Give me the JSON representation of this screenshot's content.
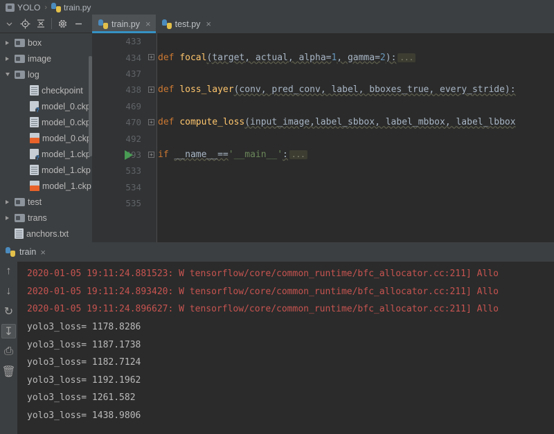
{
  "breadcrumb": {
    "project": "YOLO",
    "separator": "›",
    "file": "train.py"
  },
  "sidebar": {
    "toolbar": [
      {
        "name": "chevron-down-icon",
        "label": "▾"
      },
      {
        "name": "locate-icon",
        "label": "⊕"
      },
      {
        "name": "collapse-all-icon",
        "label": "≡"
      },
      {
        "name": "settings-gear-icon",
        "label": "⚙"
      },
      {
        "name": "hide-icon",
        "label": "—"
      }
    ],
    "tree": [
      {
        "label": "box",
        "kind": "folder",
        "expanded": false,
        "indent": 1
      },
      {
        "label": "image",
        "kind": "folder",
        "expanded": false,
        "indent": 1
      },
      {
        "label": "log",
        "kind": "folder",
        "expanded": true,
        "indent": 1
      },
      {
        "label": "checkpoint",
        "kind": "file",
        "indent": 2
      },
      {
        "label": "model_0.ckp",
        "kind": "file-q",
        "indent": 2
      },
      {
        "label": "model_0.ckp",
        "kind": "file",
        "indent": 2
      },
      {
        "label": "model_0.ckp",
        "kind": "file-red",
        "indent": 2
      },
      {
        "label": "model_1.ckp",
        "kind": "file-q",
        "indent": 2
      },
      {
        "label": "model_1.ckp",
        "kind": "file",
        "indent": 2
      },
      {
        "label": "model_1.ckp",
        "kind": "file-red",
        "indent": 2
      },
      {
        "label": "test",
        "kind": "folder",
        "expanded": false,
        "indent": 1
      },
      {
        "label": "trans",
        "kind": "folder",
        "expanded": false,
        "indent": 1
      },
      {
        "label": "anchors.txt",
        "kind": "file",
        "indent": 1
      }
    ]
  },
  "editor": {
    "tabs": [
      {
        "label": "train.py",
        "active": true,
        "close": "×"
      },
      {
        "label": "test.py",
        "active": false,
        "close": "×"
      }
    ],
    "lines": [
      {
        "number": "433",
        "fold": false,
        "run": false,
        "segments": []
      },
      {
        "number": "434",
        "fold": true,
        "run": false,
        "segments": [
          {
            "t": "def ",
            "c": "kw"
          },
          {
            "t": "focal",
            "c": "fn"
          },
          {
            "t": "(target, actual, alpha=",
            "c": "pl"
          },
          {
            "t": "1",
            "c": "num"
          },
          {
            "t": ", gamma=",
            "c": "pl"
          },
          {
            "t": "2",
            "c": "num"
          },
          {
            "t": "):",
            "c": "pl"
          },
          {
            "t": "...",
            "c": "ellipsis"
          }
        ]
      },
      {
        "number": "437",
        "fold": false,
        "run": false,
        "segments": []
      },
      {
        "number": "438",
        "fold": true,
        "run": false,
        "segments": [
          {
            "t": "def ",
            "c": "kw"
          },
          {
            "t": "loss_layer",
            "c": "fn"
          },
          {
            "t": "(conv, pred_conv, label, bboxes_true, every_stride):",
            "c": "pl"
          }
        ]
      },
      {
        "number": "469",
        "fold": false,
        "run": false,
        "segments": []
      },
      {
        "number": "470",
        "fold": true,
        "run": false,
        "segments": [
          {
            "t": "def ",
            "c": "kw"
          },
          {
            "t": "compute_loss",
            "c": "fn"
          },
          {
            "t": "(input_image,label_sbbox, label_mbbox, label_lbbox",
            "c": "pl"
          }
        ]
      },
      {
        "number": "492",
        "fold": false,
        "run": false,
        "segments": []
      },
      {
        "number": "493",
        "fold": true,
        "run": true,
        "segments": [
          {
            "t": "if ",
            "c": "kw"
          },
          {
            "t": "__name__==",
            "c": "pl"
          },
          {
            "t": "'__main__'",
            "c": "str"
          },
          {
            "t": ":",
            "c": "pl"
          },
          {
            "t": "...",
            "c": "ellipsis"
          }
        ]
      },
      {
        "number": "533",
        "fold": false,
        "run": false,
        "segments": []
      },
      {
        "number": "534",
        "fold": false,
        "run": false,
        "segments": []
      },
      {
        "number": "535",
        "fold": false,
        "run": false,
        "segments": []
      }
    ]
  },
  "console": {
    "tab": {
      "label": "train",
      "close": "×"
    },
    "gutter_buttons": [
      {
        "name": "rerun-up-icon",
        "glyph": "↑",
        "selected": false
      },
      {
        "name": "stop-down-icon",
        "glyph": "↓",
        "selected": false
      },
      {
        "name": "rerun-loop-icon",
        "glyph": "↻",
        "selected": false
      },
      {
        "name": "scroll-to-end-icon",
        "glyph": "↧",
        "selected": true
      },
      {
        "name": "print-icon",
        "glyph": "⎙",
        "selected": false
      },
      {
        "name": "trash-icon",
        "glyph": "🗑",
        "selected": false
      }
    ],
    "output": [
      {
        "text": "2020-01-05 19:11:24.881523: W tensorflow/core/common_runtime/bfc_allocator.cc:211] Allo",
        "type": "warn"
      },
      {
        "text": "2020-01-05 19:11:24.893420: W tensorflow/core/common_runtime/bfc_allocator.cc:211] Allo",
        "type": "warn"
      },
      {
        "text": "2020-01-05 19:11:24.896627: W tensorflow/core/common_runtime/bfc_allocator.cc:211] Allo",
        "type": "warn"
      },
      {
        "text": "yolo3_loss= 1178.8286",
        "type": "norm"
      },
      {
        "text": "yolo3_loss= 1187.1738",
        "type": "norm"
      },
      {
        "text": "yolo3_loss= 1182.7124",
        "type": "norm"
      },
      {
        "text": "yolo3_loss= 1192.1962",
        "type": "norm"
      },
      {
        "text": "yolo3_loss= 1261.582",
        "type": "norm"
      },
      {
        "text": "yolo3_loss= 1438.9806",
        "type": "norm"
      }
    ]
  },
  "colors": {
    "editor_bg": "#2b2b2b",
    "panel_bg": "#3c3f41",
    "gutter_bg": "#313335",
    "keyword": "#cc7832",
    "function": "#ffc66d",
    "string": "#6a8759",
    "number": "#6897bb",
    "text": "#a9b7c6",
    "warning": "#c75450",
    "tab_underline": "#3592c4",
    "run_green": "#499c54"
  }
}
